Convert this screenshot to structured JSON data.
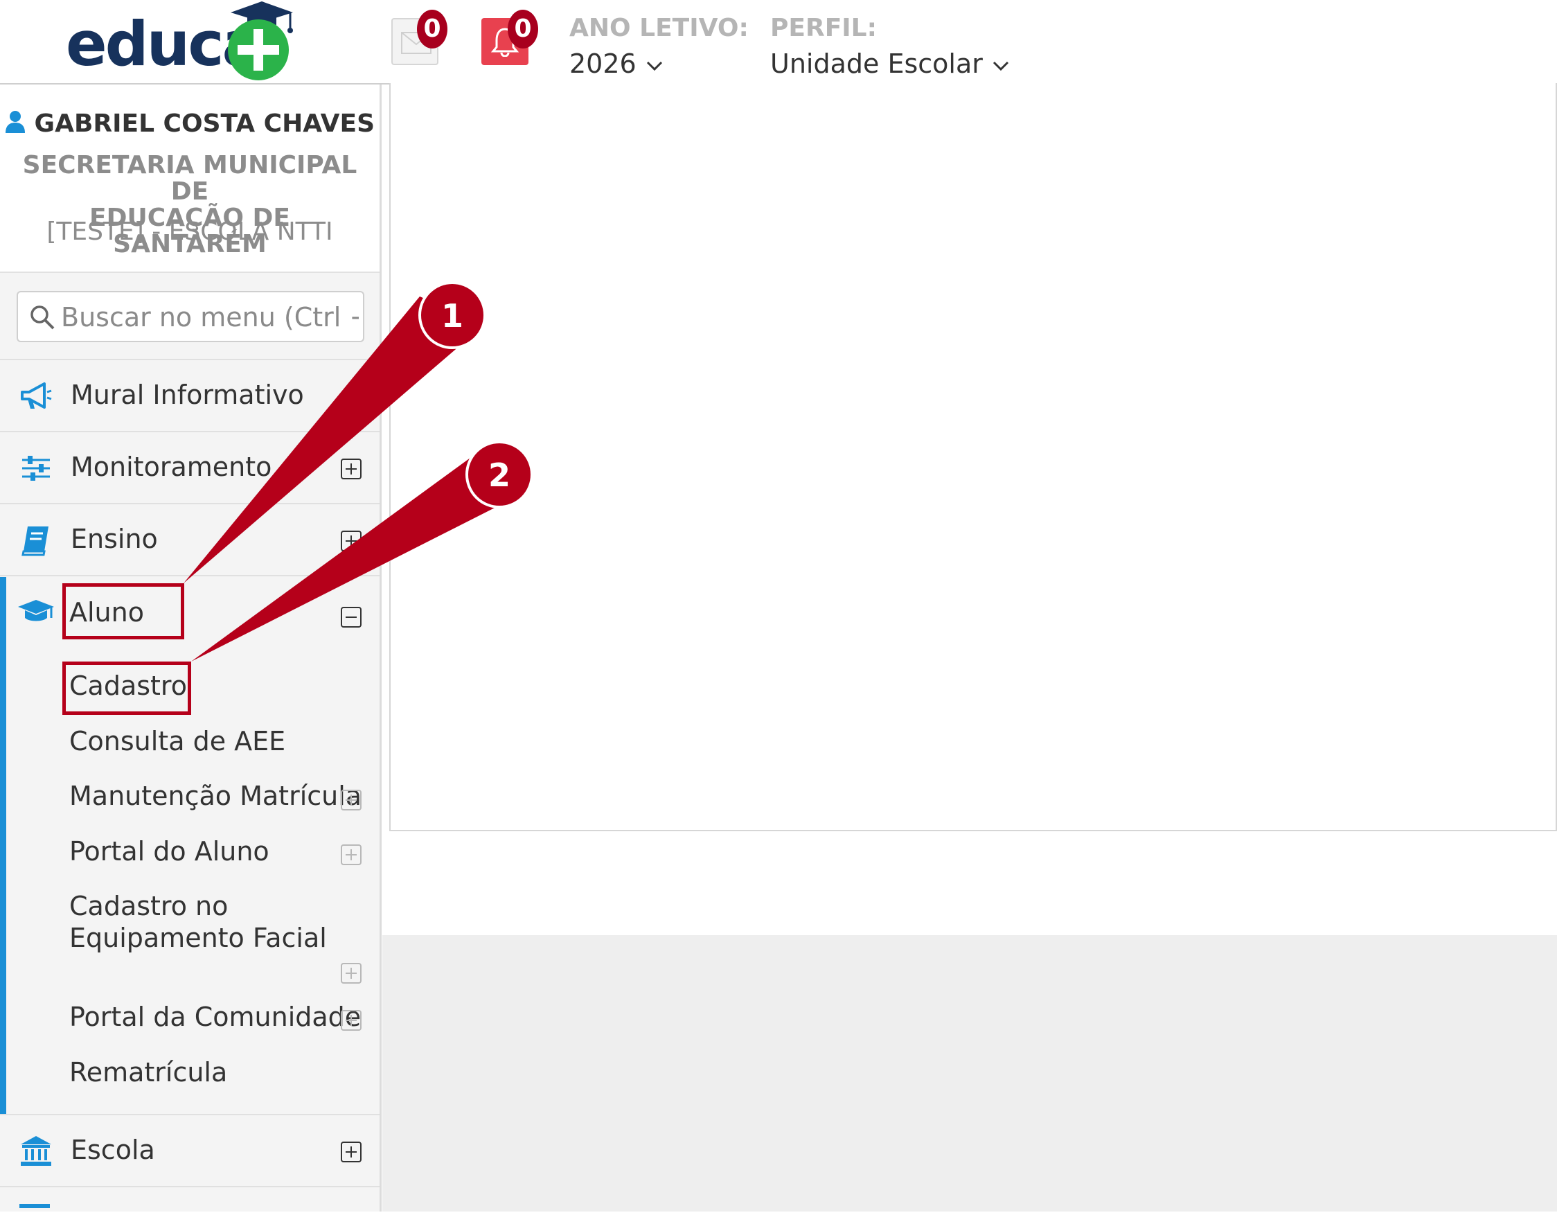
{
  "header": {
    "logo_text": "educa",
    "messages": {
      "icon": "envelope-icon",
      "count": "0"
    },
    "notifications": {
      "icon": "bell-icon",
      "count": "0"
    },
    "ano_letivo": {
      "label": "ANO LETIVO:",
      "value": "2026"
    },
    "perfil": {
      "label": "PERFIL:",
      "value": "Unidade Escolar"
    }
  },
  "profile": {
    "name": "GABRIEL COSTA CHAVES",
    "org_line1": "SECRETARIA MUNICIPAL DE",
    "org_line2": "EDUCAÇÃO DE SANTARÉM",
    "school": "[TESTE] - ESCOLA NTTI"
  },
  "search": {
    "placeholder": "Buscar no menu (Ctrl + /)"
  },
  "menu": {
    "mural": {
      "label": "Mural Informativo",
      "icon": "megaphone-icon"
    },
    "monitoramento": {
      "label": "Monitoramento",
      "icon": "sliders-icon"
    },
    "ensino": {
      "label": "Ensino",
      "icon": "book-icon"
    },
    "aluno": {
      "label": "Aluno",
      "icon": "graduation-cap-icon",
      "subitems": [
        "Cadastro",
        "Consulta de AEE",
        "Manutenção Matrícula",
        "Portal do Aluno",
        "Cadastro no",
        "Equipamento Facial",
        "Portal da Comunidade",
        "Rematrícula"
      ]
    },
    "escola": {
      "label": "Escola",
      "icon": "bank-icon"
    }
  },
  "callouts": {
    "first": "1",
    "second": "2"
  },
  "colors": {
    "accent": "#1a8fd6",
    "brand_navy": "#17325c",
    "brand_green": "#2bb34a",
    "badge": "#a8001e",
    "callout": "#b5001a"
  }
}
